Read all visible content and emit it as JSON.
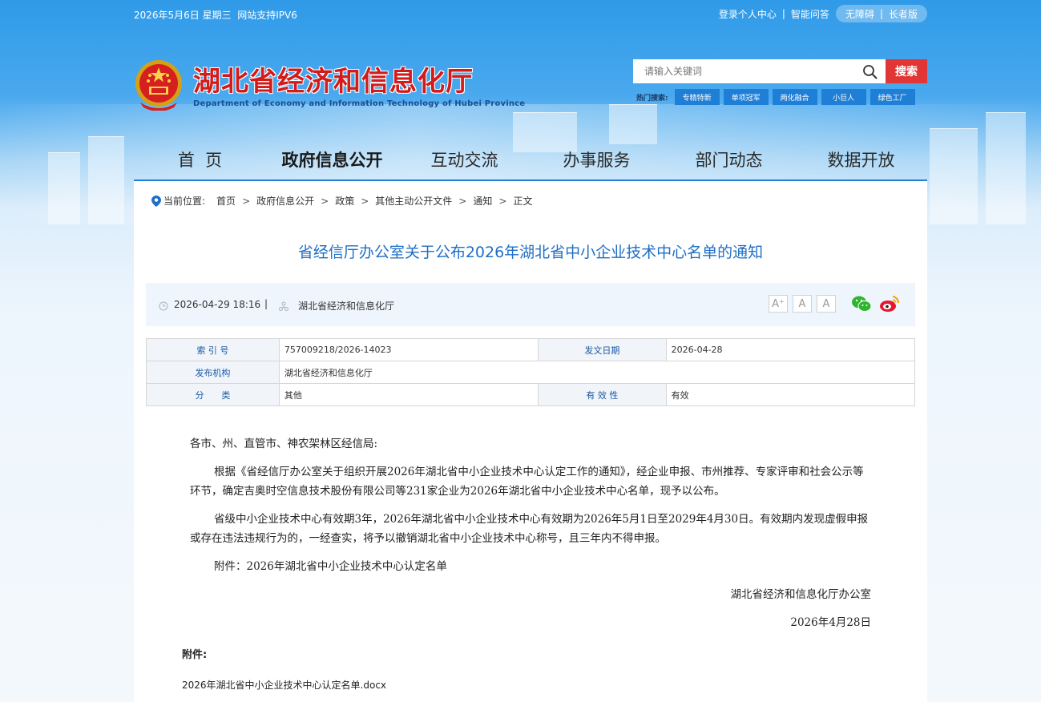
{
  "topbar": {
    "date": "2026年5月6日 星期三",
    "ipv6": "网站支持IPV6",
    "login": "登录个人中心",
    "sep": "|",
    "qa": "智能问答",
    "accessible": "无障碍",
    "elder": "长者版"
  },
  "logo": {
    "cn": "湖北省经济和信息化厅",
    "en": "Department of Economy and Information Technology of Hubei Province"
  },
  "search": {
    "placeholder": "请输入关键词",
    "button": "搜索",
    "hot_label": "热门搜索:",
    "hot_tags": [
      "专精特新",
      "单项冠军",
      "两化融合",
      "小巨人",
      "绿色工厂"
    ]
  },
  "nav": {
    "items": [
      "首  页",
      "政府信息公开",
      "互动交流",
      "办事服务",
      "部门动态",
      "数据开放"
    ]
  },
  "breadcrumb": {
    "label": "当前位置:",
    "items": [
      "首页",
      "政府信息公开",
      "政策",
      "其他主动公开文件",
      "通知",
      "正文"
    ],
    "sep": ">"
  },
  "article": {
    "title": "省经信厅办公室关于公布2026年湖北省中小企业技术中心名单的通知",
    "datetime": "2026-04-29 18:16",
    "meta_sep": "|",
    "org": "湖北省经济和信息化厅",
    "font_buttons": [
      "A⁺",
      "A",
      "A"
    ],
    "info": {
      "index_label": "索 引 号",
      "index_value": "757009218/2026-14023",
      "date_label": "发文日期",
      "date_value": "2026-04-28",
      "org_label": "发布机构",
      "org_value": "湖北省经济和信息化厅",
      "cat_label": "分　　类",
      "cat_value": "其他",
      "valid_label": "有 效 性",
      "valid_value": "有效"
    },
    "salutation": "各市、州、直管市、神农架林区经信局:",
    "p1": "根据《省经信厅办公室关于组织开展2026年湖北省中小企业技术中心认定工作的通知》，经企业申报、市州推荐、专家评审和社会公示等环节，确定吉奥时空信息技术股份有限公司等231家企业为2026年湖北省中小企业技术中心名单，现予以公布。",
    "p2": "省级中小企业技术中心有效期3年，2026年湖北省中小企业技术中心有效期为2026年5月1日至2029年4月30日。有效期内发现虚假申报或存在违法违规行为的，一经查实，将予以撤销湖北省中小企业技术中心称号，且三年内不得申报。",
    "p3": "附件：2026年湖北省中小企业技术中心认定名单",
    "signature": "湖北省经济和信息化厅办公室",
    "sign_date": "2026年4月28日",
    "attach_label": "附件:",
    "attach_file": "2026年湖北省中小企业技术中心认定名单.docx"
  }
}
